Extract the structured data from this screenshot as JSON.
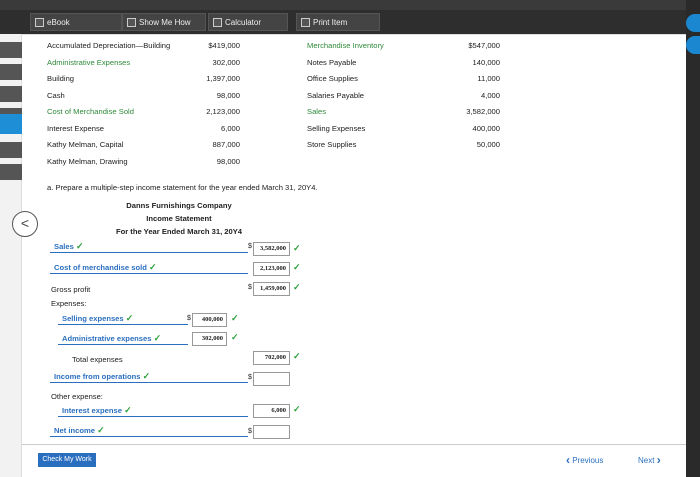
{
  "toolbar": {
    "ebook": "eBook",
    "show_me_how": "Show Me How",
    "calculator": "Calculator",
    "print_item": "Print Item"
  },
  "accounts_left": [
    {
      "label": "Accumulated Depreciation—Building",
      "value": "$419,000",
      "highlight": false
    },
    {
      "label": "Administrative Expenses",
      "value": "302,000",
      "highlight": true
    },
    {
      "label": "Building",
      "value": "1,397,000",
      "highlight": false
    },
    {
      "label": "Cash",
      "value": "98,000",
      "highlight": false
    },
    {
      "label": "Cost of Merchandise Sold",
      "value": "2,123,000",
      "highlight": true
    },
    {
      "label": "Interest Expense",
      "value": "6,000",
      "highlight": false
    },
    {
      "label": "Kathy Melman, Capital",
      "value": "887,000",
      "highlight": false
    },
    {
      "label": "Kathy Melman, Drawing",
      "value": "98,000",
      "highlight": false
    }
  ],
  "accounts_right": [
    {
      "label": "Merchandise Inventory",
      "value": "$547,000",
      "highlight": true
    },
    {
      "label": "Notes Payable",
      "value": "140,000",
      "highlight": false
    },
    {
      "label": "Office Supplies",
      "value": "11,000",
      "highlight": false
    },
    {
      "label": "Salaries Payable",
      "value": "4,000",
      "highlight": false
    },
    {
      "label": "Sales",
      "value": "3,582,000",
      "highlight": true
    },
    {
      "label": "Selling Expenses",
      "value": "400,000",
      "highlight": false
    },
    {
      "label": "Store Supplies",
      "value": "50,000",
      "highlight": false
    }
  ],
  "prompt": "a. Prepare a multiple-step income statement for the year ended March 31, 20Y4.",
  "statement": {
    "company": "Danns Furnishings Company",
    "title": "Income Statement",
    "period": "For the Year Ended March 31, 20Y4",
    "sales_label": "Sales",
    "sales_value": "3,582,000",
    "cogs_label": "Cost of merchandise sold",
    "cogs_value": "2,123,000",
    "gross_profit_label": "Gross profit",
    "gross_profit_value": "1,459,000",
    "expenses_label": "Expenses:",
    "selling_label": "Selling expenses",
    "selling_value": "400,000",
    "admin_label": "Administrative expenses",
    "admin_value": "302,000",
    "total_expenses_label": "Total expenses",
    "total_expenses_value": "702,000",
    "income_ops_label": "Income from operations",
    "income_ops_value": "",
    "other_expense_label": "Other expense:",
    "interest_label": "Interest expense",
    "interest_value": "6,000",
    "net_income_label": "Net income",
    "net_income_value": "",
    "dollar": "$",
    "check": "✓"
  },
  "footer": {
    "check_my_work": "Check My Work",
    "previous": "Previous",
    "next": "Next"
  },
  "colors": {
    "accent": "#2a6fbf",
    "check": "#2aa03a",
    "highlight_text": "#2f8a3a"
  }
}
